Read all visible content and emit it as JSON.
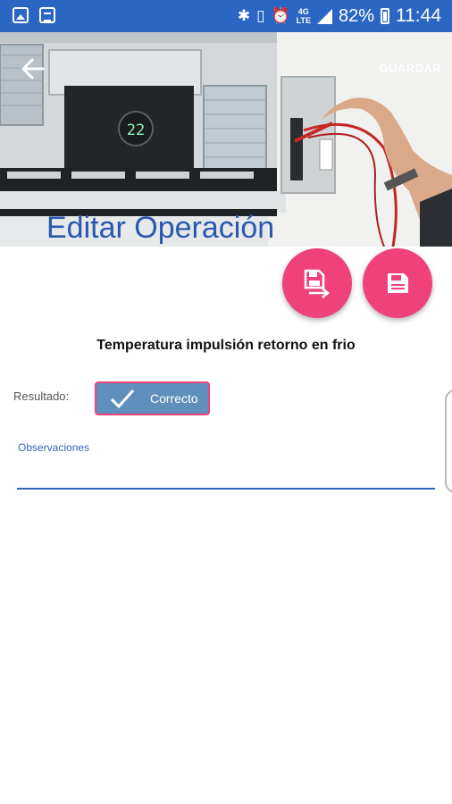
{
  "status_bar": {
    "left_icons": [
      "image-icon",
      "message-icon"
    ],
    "right_icons": [
      "bluetooth-icon",
      "vibrate-icon",
      "alarm-icon"
    ],
    "network": "4G",
    "network_sub": "LTE",
    "battery": "82%",
    "time": "11:44"
  },
  "header": {
    "save_label": "GUARDAR",
    "title": "Editar Operación",
    "display_reading": "22"
  },
  "operation": {
    "title": "Temperatura impulsión retorno en frio",
    "result_label": "Resultado:",
    "result_value": "Correcto",
    "observations_label": "Observaciones",
    "observations_value": ""
  },
  "colors": {
    "status_bar": "#2c66c5",
    "accent": "#f0427a",
    "primary": "#2a58b0",
    "button": "#5f8fbc"
  }
}
